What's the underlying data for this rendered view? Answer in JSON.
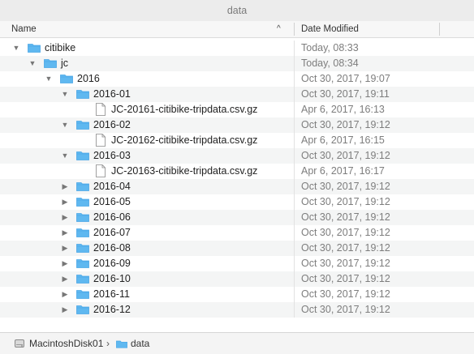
{
  "window": {
    "title": "data"
  },
  "columns": {
    "name": "Name",
    "date_modified": "Date Modified",
    "sort_indicator": "^"
  },
  "rows": [
    {
      "name": "citibike",
      "date": "Today, 08:33",
      "type": "folder",
      "depth": 0,
      "expanded": true
    },
    {
      "name": "jc",
      "date": "Today, 08:34",
      "type": "folder",
      "depth": 1,
      "expanded": true
    },
    {
      "name": "2016",
      "date": "Oct 30, 2017, 19:07",
      "type": "folder",
      "depth": 2,
      "expanded": true
    },
    {
      "name": "2016-01",
      "date": "Oct 30, 2017, 19:11",
      "type": "folder",
      "depth": 3,
      "expanded": true
    },
    {
      "name": "JC-20161-citibike-tripdata.csv.gz",
      "date": "Apr 6, 2017, 16:13",
      "type": "file",
      "depth": 4
    },
    {
      "name": "2016-02",
      "date": "Oct 30, 2017, 19:12",
      "type": "folder",
      "depth": 3,
      "expanded": true
    },
    {
      "name": "JC-20162-citibike-tripdata.csv.gz",
      "date": "Apr 6, 2017, 16:15",
      "type": "file",
      "depth": 4
    },
    {
      "name": "2016-03",
      "date": "Oct 30, 2017, 19:12",
      "type": "folder",
      "depth": 3,
      "expanded": true
    },
    {
      "name": "JC-20163-citibike-tripdata.csv.gz",
      "date": "Apr 6, 2017, 16:17",
      "type": "file",
      "depth": 4
    },
    {
      "name": "2016-04",
      "date": "Oct 30, 2017, 19:12",
      "type": "folder",
      "depth": 3,
      "expanded": false
    },
    {
      "name": "2016-05",
      "date": "Oct 30, 2017, 19:12",
      "type": "folder",
      "depth": 3,
      "expanded": false
    },
    {
      "name": "2016-06",
      "date": "Oct 30, 2017, 19:12",
      "type": "folder",
      "depth": 3,
      "expanded": false
    },
    {
      "name": "2016-07",
      "date": "Oct 30, 2017, 19:12",
      "type": "folder",
      "depth": 3,
      "expanded": false
    },
    {
      "name": "2016-08",
      "date": "Oct 30, 2017, 19:12",
      "type": "folder",
      "depth": 3,
      "expanded": false
    },
    {
      "name": "2016-09",
      "date": "Oct 30, 2017, 19:12",
      "type": "folder",
      "depth": 3,
      "expanded": false
    },
    {
      "name": "2016-10",
      "date": "Oct 30, 2017, 19:12",
      "type": "folder",
      "depth": 3,
      "expanded": false
    },
    {
      "name": "2016-11",
      "date": "Oct 30, 2017, 19:12",
      "type": "folder",
      "depth": 3,
      "expanded": false
    },
    {
      "name": "2016-12",
      "date": "Oct 30, 2017, 19:12",
      "type": "folder",
      "depth": 3,
      "expanded": false
    }
  ],
  "path_bar": {
    "disk": "MacintoshDisk01",
    "separator": "›",
    "folder": "data"
  },
  "icons": {
    "folder": "folder-icon",
    "file": "document-icon",
    "disk": "hard-disk-icon",
    "expanded": "disclosure-triangle-down-icon",
    "collapsed": "disclosure-triangle-right-icon"
  },
  "colors": {
    "folder": "#5fb8f0",
    "folder_tab": "#4aa6e6",
    "date_text": "#7d7d7d"
  }
}
